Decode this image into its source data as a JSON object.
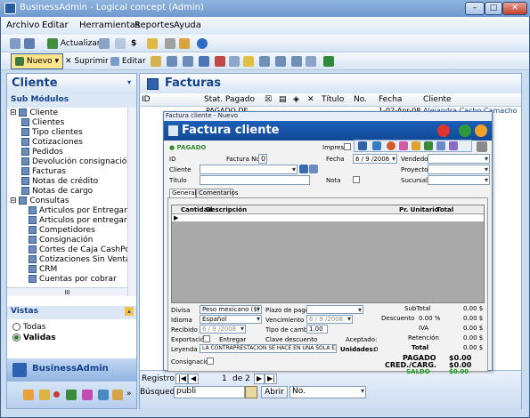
{
  "window": {
    "title": "BusinessAdmin - Logical concept (Admin)"
  },
  "menu": [
    "Archivo",
    "Editar",
    "Herramientas",
    "Reportes",
    "Ayuda"
  ],
  "toolbar1": {
    "actualizar": "Actualizar"
  },
  "toolbar2": {
    "nuevo": "Nuevo",
    "suprimir": "Suprimir",
    "editar": "Editar"
  },
  "left": {
    "title": "Cliente",
    "submodulos": "Sub Módulos",
    "tree": [
      "Cliente",
      "Clientes",
      "Tipo clientes",
      "Cotizaciones",
      "Pedidos",
      "Devolución consignación",
      "Facturas",
      "Notas de crédito",
      "Notas de cargo",
      "Consultas",
      "Articulos por Entregar",
      "Articulos por entregar",
      "Competidores",
      "Consignación",
      "Cortes de Caja CashPoi",
      "Cotizaciones Sin Venta",
      "CRM",
      "Cuentas por cobrar"
    ],
    "hscroll": "III",
    "vistas": "Vistas",
    "todas": "Todas",
    "validas": "Validas",
    "app": "BusinessAdmin"
  },
  "main": {
    "title": "Facturas",
    "columns": [
      "ID",
      "Stat. Pagado",
      "Título",
      "No.",
      "Fecha",
      "Cliente"
    ],
    "row": {
      "status": "PAGADO DE",
      "no": "1",
      "fecha": "1-02-Apr-08",
      "cliente": "Alejandra Cacho Camacho"
    },
    "registro": "Registro:",
    "page": "1",
    "of": "de 2",
    "busqueda": "Búsqueda",
    "search": "publi",
    "abrir": "Abrir",
    "no_option": "No."
  },
  "dialog": {
    "window_title": "Factura cliente - Nuevo",
    "heading": "Factura cliente",
    "status": "PAGADO",
    "impreso": "Impreso",
    "id": "ID",
    "factura_no": "Factura No.",
    "factura_val": "0",
    "fecha": "Fecha",
    "fecha_val": "6 / 9 /2008",
    "vendedor": "Vendedor",
    "cliente": "Cliente",
    "proyecto": "Proyecto",
    "titulo": "Título",
    "nota": "Nota",
    "sucursal": "Sucursal",
    "tabs": [
      "General",
      "Comentarios"
    ],
    "grid_cols": [
      "Cantidad",
      "Descripción",
      "Pr. Unitario",
      "Total"
    ],
    "divisa": "Divisa",
    "divisa_val": "Peso mexicano ($)",
    "plazo": "Plazo de pago",
    "idioma": "Idioma",
    "idioma_val": "Español",
    "vencimiento": "Vencimiento",
    "venc_val": "6 / 9 /2008",
    "recibido": "Recibido",
    "recibido_val": "6 / 9 /2008",
    "tipo_cambio": "Tipo de cambio",
    "tc_val": "1.00",
    "exportacion": "Exportación",
    "entregar": "Entregar",
    "clave": "Clave descuento",
    "aceptado": "Aceptado:",
    "leyenda": "Leyenda",
    "leyenda_val": "LA CONTRAPRESTACION SE HACE EN UNA SOLA EXHI",
    "unidades": "Unidades:",
    "unidades_val": "0",
    "consignacion": "Consignación",
    "subtotal": "SubTotal",
    "subtotal_val": "0.00 $",
    "descuento": "Descuento",
    "desc_pct": "0.00 %",
    "desc_val": "0.00 $",
    "iva": "IVA",
    "iva_val": "0.00 $",
    "retencion": "Retención",
    "ret_val": "0.00 $",
    "total": "Total",
    "total_val": "0.00 $",
    "pagado": "PAGADO",
    "pagado_val": "$0.00",
    "cred": "CRED./CARG.",
    "cred_val": "$0.00",
    "saldo": "SALDO",
    "saldo_val": "$0.00"
  }
}
